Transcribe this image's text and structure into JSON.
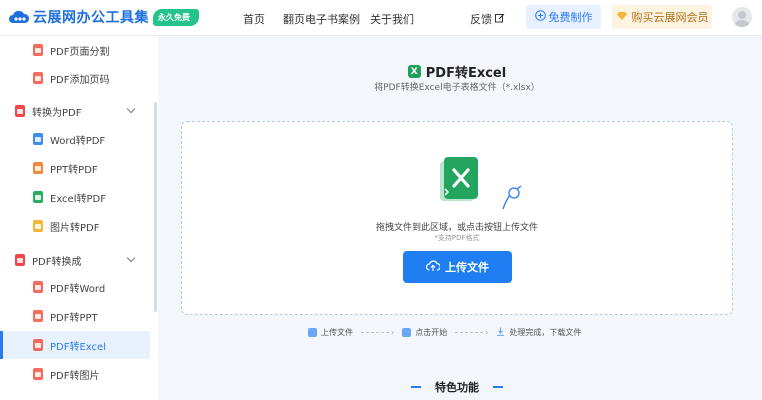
{
  "header": {
    "logo_text": "云展网办公工具集",
    "badge": "永久免费",
    "nav": [
      "首页",
      "翻页电子书案例",
      "关于我们"
    ],
    "feedback": "反馈",
    "free_make": "免费制作",
    "buy_vip": "购买云展网会员"
  },
  "sidebar": {
    "items": [
      {
        "label": "PDF页面分割",
        "kind": "sub",
        "icon_color": "#f26b5b"
      },
      {
        "label": "PDF添加页码",
        "kind": "sub",
        "icon_color": "#f26b5b"
      },
      {
        "label": "转换为PDF",
        "kind": "group",
        "icon_color": "#f04848"
      },
      {
        "label": "Word转PDF",
        "kind": "sub",
        "icon_color": "#3d8ef0"
      },
      {
        "label": "PPT转PDF",
        "kind": "sub",
        "icon_color": "#f08a3a"
      },
      {
        "label": "Excel转PDF",
        "kind": "sub",
        "icon_color": "#2aab5f"
      },
      {
        "label": "图片转PDF",
        "kind": "sub",
        "icon_color": "#f5b53b"
      },
      {
        "label": "PDF转换成",
        "kind": "group",
        "icon_color": "#f04848"
      },
      {
        "label": "PDF转Word",
        "kind": "sub",
        "icon_color": "#f26b5b"
      },
      {
        "label": "PDF转PPT",
        "kind": "sub",
        "icon_color": "#f26b5b"
      },
      {
        "label": "PDF转Excel",
        "kind": "active",
        "icon_color": "#f26b5b"
      },
      {
        "label": "PDF转图片",
        "kind": "sub",
        "icon_color": "#f26b5b"
      }
    ]
  },
  "main": {
    "title": "PDF转Excel",
    "subtitle": "将PDF转换Excel电子表格文件（*.xlsx）",
    "drop_hint": "拖拽文件到此区域，或点击按钮上传文件",
    "drop_sub": "*支持PDF格式",
    "upload_label": "上传文件",
    "steps": [
      "上传文件",
      "点击开始",
      "处理完成，下载文件"
    ],
    "feature_title": "特色功能"
  },
  "colors": {
    "primary": "#1f7ff2",
    "excel_green": "#1f9e5c",
    "badge_green": "#23c38a"
  }
}
